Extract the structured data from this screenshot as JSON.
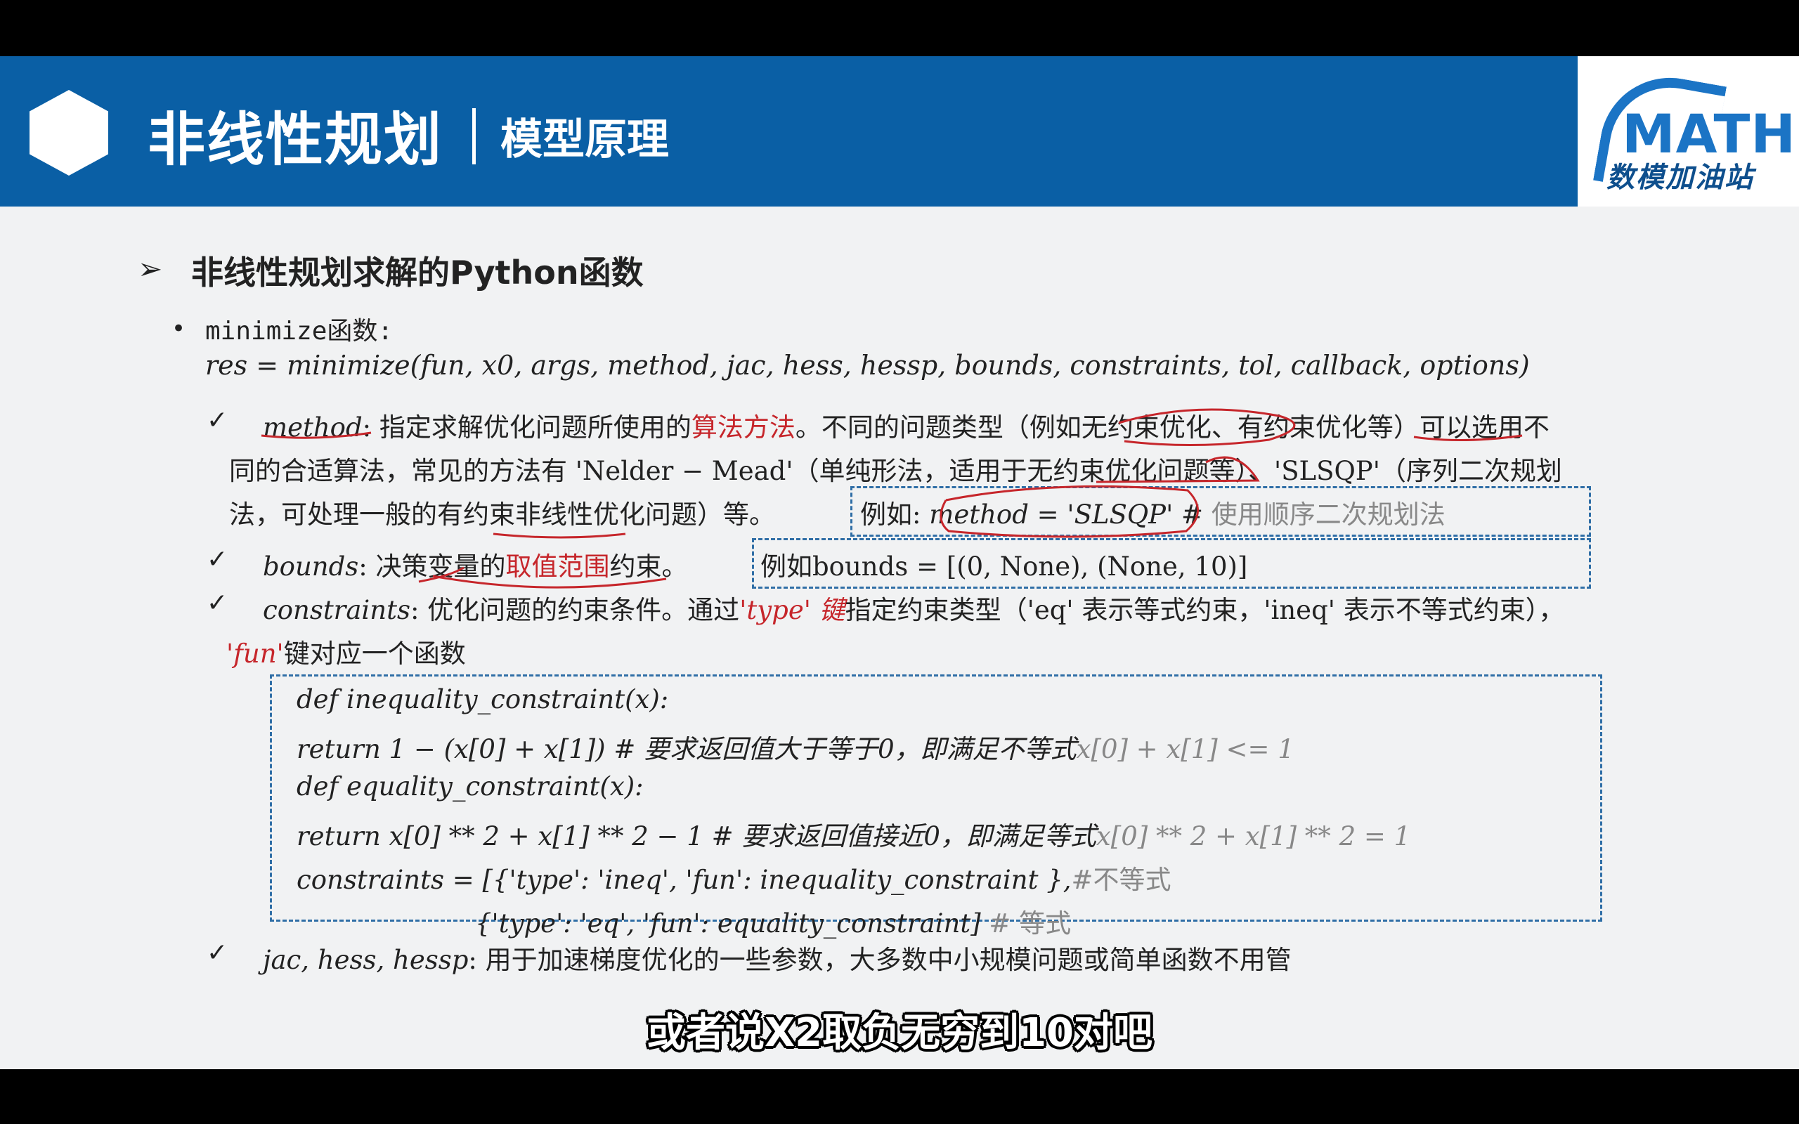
{
  "header": {
    "title": "非线性规划",
    "separator": "|",
    "subtitle": "模型原理"
  },
  "logo": {
    "text": "MATH",
    "cn": "数模加油站"
  },
  "section": {
    "arrow": "➢",
    "title": "非线性规划求解的Python函数"
  },
  "minimize": {
    "bullet": "•",
    "label": "minimize函数:",
    "formula": "res = minimize(fun, x0, args, method, jac, hess, hessp, bounds, constraints, tol, callback, options)"
  },
  "method_item": {
    "check": "✓",
    "l1_name": "method",
    "l1_a": ": 指定求解优化问题所使用的",
    "l1_red": "算法方法",
    "l1_b": "。不同的问题类型（例如无约束优化、有约束优化等）可以选用不",
    "l2": "同的合适算法，常见的方法有 'Nelder − Mead'（单纯形法，适用于无约束优化问题等）、'SLSQP'（序列二次规划",
    "l3": "法，可处理一般的有约束非线性优化问题）等。",
    "example_a": "例如:",
    "example_b": "method = 'SLSQP'",
    "example_c": "#",
    "example_comment": "使用顺序二次规划法"
  },
  "bounds_item": {
    "check": "✓",
    "name": "bounds",
    "a": ": 决策变量的",
    "red": "取值范围",
    "b": "约束。",
    "example": "例如bounds = [(0, None), (None, 10)]"
  },
  "constraints_item": {
    "check": "✓",
    "name": "constraints",
    "a": ": 优化问题的约束条件。通过",
    "red1": "'type' 键",
    "b": "指定约束类型（'eq' 表示等式约束，'ineq' 表示不等式约束），",
    "red2": "'fun'",
    "c": "键对应一个函数"
  },
  "code": {
    "l1": "def inequality_constraint(x):",
    "l2a": "return 1 − (x[0] + x[1]) # 要求返回值大于等于0，即满足不等式",
    "l2b": "x[0] + x[1] <= 1",
    "l3": "def equality_constraint(x):",
    "l4a": "return x[0] ** 2 + x[1] ** 2 − 1 # 要求返回值接近0，即满足等式",
    "l4b": "x[0] ** 2 + x[1] ** 2 = 1",
    "l5a": "constraints = [{'type': 'ineq',      'fun': inequality_constraint },",
    "l5b": "#不等式",
    "l6a": "{'type': 'eq', 'fun': equality_constraint]",
    "l6b": "# 等式"
  },
  "jac_item": {
    "check": "✓",
    "name": "jac, hess, hessp",
    "text": ": 用于加速梯度优化的一些参数，大多数中小规模问题或简单函数不用管"
  },
  "caption": "或者说X2取负无穷到10对吧",
  "colors": {
    "header_blue": "#0a5fa5",
    "accent_red": "#c6262b",
    "box_blue": "#2f6ea6"
  }
}
